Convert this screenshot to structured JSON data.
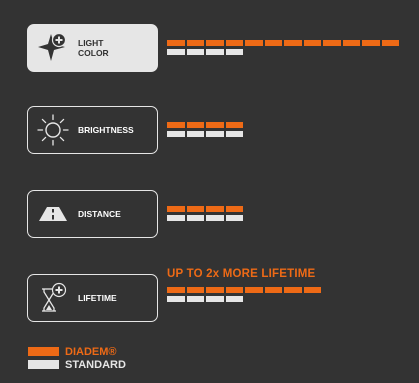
{
  "colors": {
    "background": "#333333",
    "diadem": "#ee6a16",
    "standard": "#e6e6e6"
  },
  "features": [
    {
      "label": "LIGHT\nCOLOR",
      "icon": "light-color-icon",
      "active": true,
      "diadem_segments": 12,
      "standard_segments": 4
    },
    {
      "label": "BRIGHTNESS",
      "icon": "sun-icon",
      "active": false,
      "diadem_segments": 4,
      "standard_segments": 4
    },
    {
      "label": "DISTANCE",
      "icon": "road-icon",
      "active": false,
      "diadem_segments": 4,
      "standard_segments": 4
    },
    {
      "label": "LIFETIME",
      "icon": "hourglass-plus-icon",
      "active": false,
      "diadem_segments": 8,
      "standard_segments": 4,
      "headline": "UP TO 2x MORE LIFETIME"
    }
  ],
  "legend": {
    "diadem": "DIADEM®",
    "standard": "STANDARD"
  }
}
